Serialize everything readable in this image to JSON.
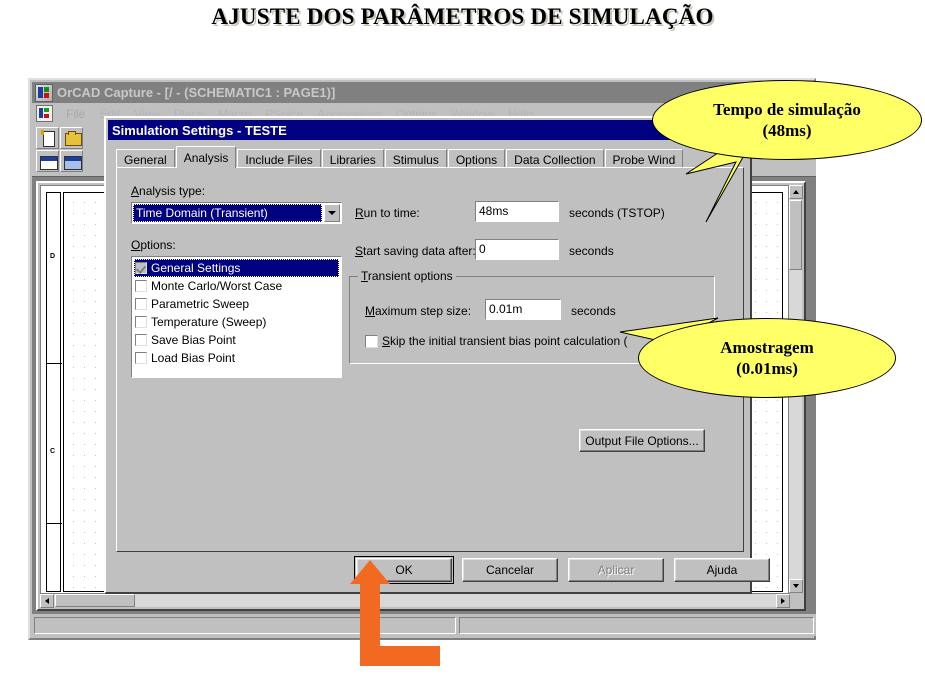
{
  "page": {
    "heading": "AJUSTE DOS PARÂMETROS DE SIMULAÇÃO"
  },
  "app_window": {
    "title": "OrCAD Capture - [/ - (SCHEMATIC1 : PAGE1)]",
    "menu": [
      "File",
      "Edit",
      "View",
      "Place",
      "Macro",
      "PSpice",
      "Accessories",
      "Options",
      "Window",
      "Help"
    ],
    "toolbar_icons": [
      "new-file-icon",
      "open-folder-icon",
      "new-window-icon",
      "window-icon"
    ],
    "schematic": {
      "zone_labels": [
        "D",
        "C"
      ]
    },
    "statusbar": {
      "left_text": "",
      "right_text": ""
    }
  },
  "dialog": {
    "title": "Simulation Settings - TESTE",
    "tabs": [
      {
        "label": "General",
        "selected": false
      },
      {
        "label": "Analysis",
        "selected": true
      },
      {
        "label": "Include Files",
        "selected": false
      },
      {
        "label": "Libraries",
        "selected": false
      },
      {
        "label": "Stimulus",
        "selected": false
      },
      {
        "label": "Options",
        "selected": false
      },
      {
        "label": "Data Collection",
        "selected": false
      },
      {
        "label": "Probe Wind",
        "selected": false
      }
    ],
    "analysis": {
      "analysis_type_label": "Analysis type:",
      "analysis_type_value": "Time Domain (Transient)",
      "options_label": "Options:",
      "options": [
        {
          "label": "General Settings",
          "checked": true,
          "selected": true
        },
        {
          "label": "Monte Carlo/Worst Case",
          "checked": false,
          "selected": false
        },
        {
          "label": "Parametric Sweep",
          "checked": false,
          "selected": false
        },
        {
          "label": "Temperature (Sweep)",
          "checked": false,
          "selected": false
        },
        {
          "label": "Save Bias Point",
          "checked": false,
          "selected": false
        },
        {
          "label": "Load Bias Point",
          "checked": false,
          "selected": false
        }
      ],
      "run_to_time_label": "Run to time:",
      "run_to_time_value": "48ms",
      "run_to_time_units": "seconds  (TSTOP)",
      "start_saving_label": "Start saving data after:",
      "start_saving_value": "0",
      "start_saving_units": "seconds",
      "transient_group_title": "Transient options",
      "max_step_label": "Maximum step size:",
      "max_step_value": "0.01m",
      "max_step_units": "seconds",
      "skip_bias_label": "Skip the initial transient bias point calculation  (",
      "skip_bias_checked": false,
      "output_file_options_label": "Output File Options..."
    },
    "buttons": {
      "ok": "OK",
      "cancel": "Cancelar",
      "apply": "Aplicar",
      "help": "Ajuda"
    }
  },
  "callouts": [
    {
      "name": "simulation-time-callout",
      "line1": "Tempo de simulação",
      "line2": "(48ms)"
    },
    {
      "name": "sampling-callout",
      "line1": "Amostragem",
      "line2": "(0.01ms)"
    }
  ],
  "colors": {
    "callout_fill": "#ffff66",
    "arrow": "#f26a21",
    "dialog_titlebar": "#000080",
    "window_face": "#c0c0c0"
  }
}
